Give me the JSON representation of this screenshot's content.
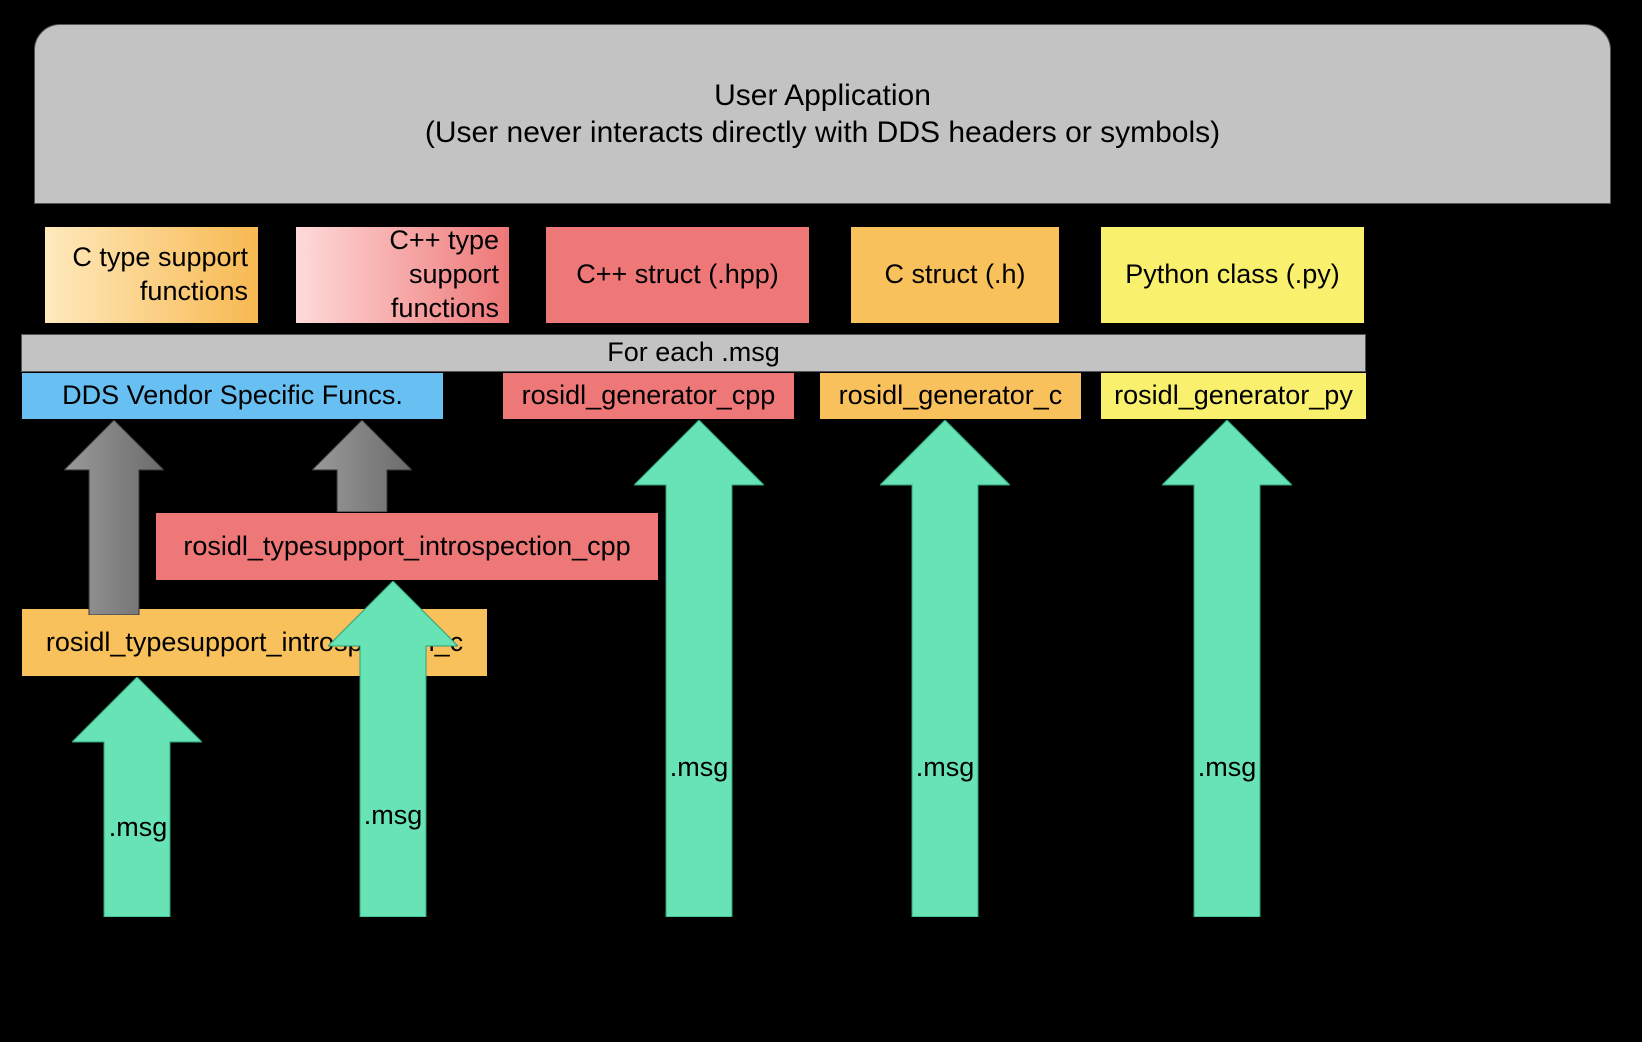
{
  "user_app": {
    "line1": "User Application",
    "line2": "(User never interacts directly with DDS headers or symbols)"
  },
  "row1": {
    "c_ts": "C type support functions",
    "cpp_ts": "C++ type support functions",
    "cpp_struct": "C++ struct (.hpp)",
    "c_struct": "C struct (.h)",
    "py_class": "Python class (.py)"
  },
  "each_bar": "For each .msg",
  "row2": {
    "dds": "DDS Vendor Specific Funcs.",
    "gen_cpp": "rosidl_generator_cpp",
    "gen_c": "rosidl_generator_c",
    "gen_py": "rosidl_generator_py"
  },
  "introspection": {
    "cpp": "rosidl_typesupport_introspection_cpp",
    "c": "rosidl_typesupport_introspection_c"
  },
  "msg_label": ".msg"
}
